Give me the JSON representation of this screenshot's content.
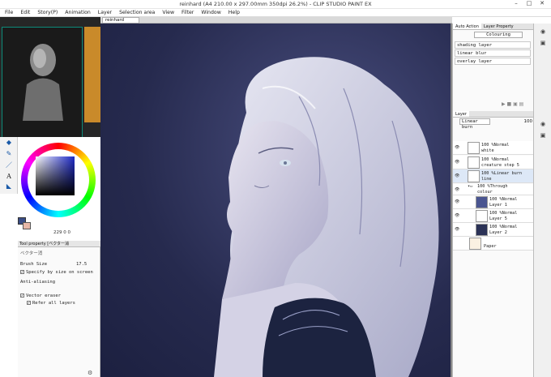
{
  "window": {
    "title": "reinhard (A4 210.00 x 297.00mm 350dpi 26.2%) - CLIP STUDIO PAINT EX"
  },
  "menu": [
    "File",
    "Edit",
    "Story(P)",
    "Animation",
    "Layer",
    "Selection area",
    "View",
    "Filter",
    "Window",
    "Help"
  ],
  "document_tab": {
    "label": "reinhard"
  },
  "tools": {
    "icons": [
      "fill-bucket-icon",
      "paint-icon",
      "pen-icon",
      "text-icon",
      "ruler-icon"
    ]
  },
  "color": {
    "main": "#3a4d86",
    "sub": "#e8b8a8",
    "values": "229 0 0"
  },
  "tool_property": {
    "tabs": [
      "Tool property [ベクター消",
      "ベクター消"
    ],
    "brush_size_label": "Brush Size",
    "brush_size_value": "17.5",
    "specify_by_size": "Specify by size on screen",
    "anti_aliasing_label": "Anti-aliasing",
    "vector_eraser": "Vector eraser",
    "refer_all_layers": "Refer all layers"
  },
  "auto_action": {
    "tabs": [
      "Auto Action",
      "Layer Property"
    ],
    "set": "Colouring",
    "items": [
      "shading layer",
      "linear blur",
      "overlay layer"
    ]
  },
  "layer_panel": {
    "tab": "Layer",
    "blend_mode": "Linear burn",
    "opacity": "100",
    "layers": [
      {
        "line1": "100 %Normal",
        "line2": "white"
      },
      {
        "line1": "100 %Normal",
        "line2": "creature step 5"
      },
      {
        "line1": "100 %Linear burn",
        "line2": "line"
      },
      {
        "line1": "100 %Through",
        "line2": "colour"
      },
      {
        "line1": "100 %Normal",
        "line2": "Layer 1"
      },
      {
        "line1": "100 %Normal",
        "line2": "Layer 5"
      },
      {
        "line1": "100 %Normal",
        "line2": "Layer 2"
      },
      {
        "line1": "",
        "line2": "Paper"
      }
    ]
  }
}
